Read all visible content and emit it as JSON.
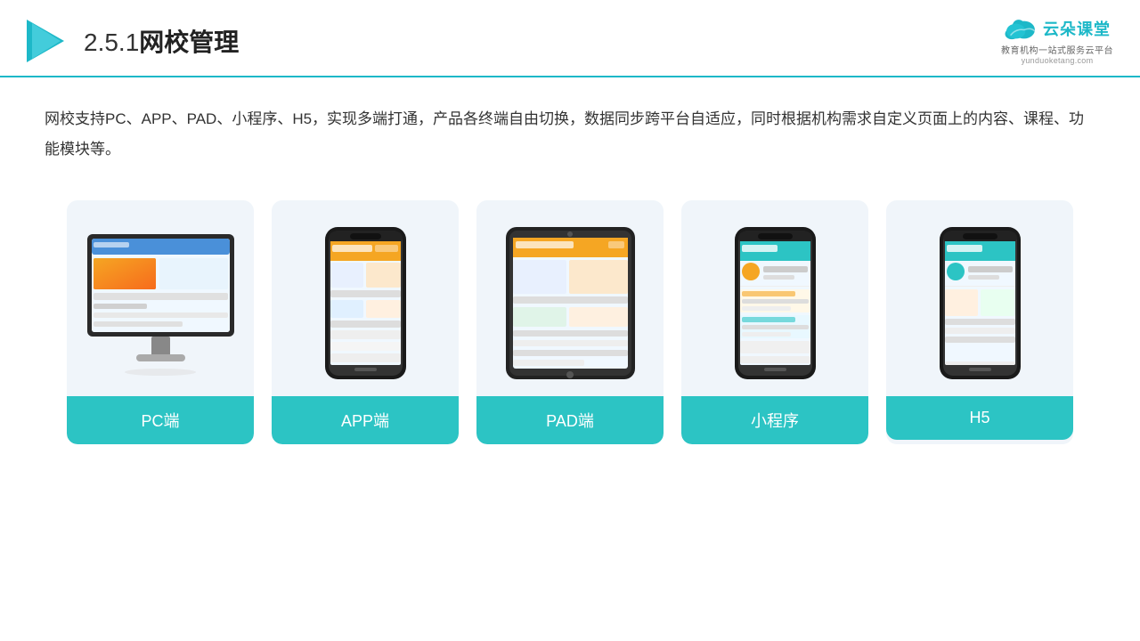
{
  "header": {
    "section_number": "2.5.1",
    "title": "网校管理",
    "logo": {
      "name": "云朵课堂",
      "url": "yunduoketang.com",
      "tagline": "教育机构一站\n式服务云平台"
    }
  },
  "description": {
    "text": "网校支持PC、APP、PAD、小程序、H5，实现多端打通，产品各终端自由切换，数据同步跨平台自适应，同时根据机构需求自定义页面上的内容、课程、功能模块等。"
  },
  "cards": [
    {
      "id": "pc",
      "label": "PC端",
      "device_type": "pc"
    },
    {
      "id": "app",
      "label": "APP端",
      "device_type": "mobile"
    },
    {
      "id": "pad",
      "label": "PAD端",
      "device_type": "tablet"
    },
    {
      "id": "miniapp",
      "label": "小程序",
      "device_type": "mobile"
    },
    {
      "id": "h5",
      "label": "H5",
      "device_type": "mobile"
    }
  ],
  "brand_color": "#2cc4c4",
  "accent_color": "#1db8c8"
}
